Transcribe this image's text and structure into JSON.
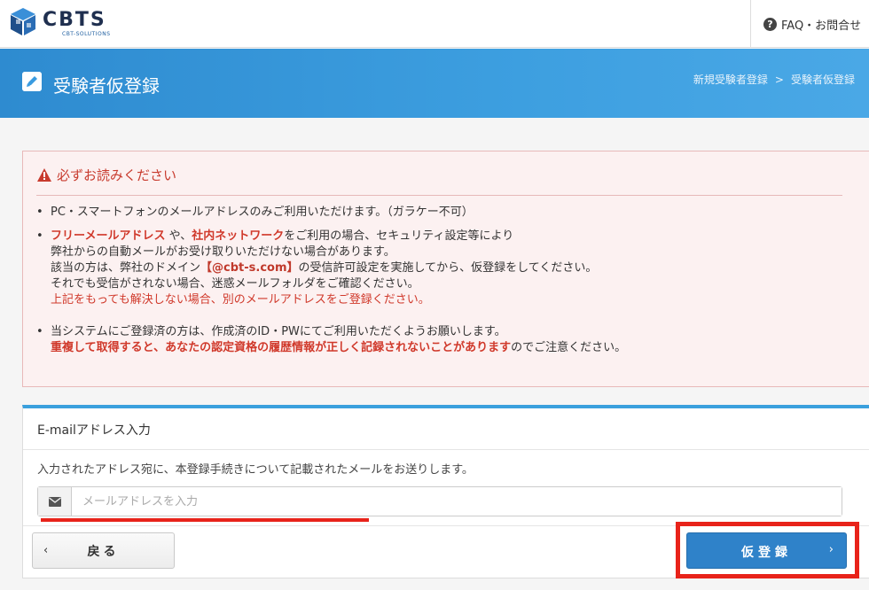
{
  "header": {
    "logo_text": "CBTS",
    "logo_sub": "CBT-SOLUTIONS",
    "faq_label": "FAQ・お問合せ"
  },
  "banner": {
    "title": "受験者仮登録",
    "breadcrumb": [
      "新規受験者登録",
      "受験者仮登録"
    ],
    "breadcrumb_sep": ">"
  },
  "notice": {
    "title": "必ずお読みください",
    "item1": "PC・スマートフォンのメールアドレスのみご利用いただけます。（ガラケー不可）",
    "item2": {
      "free_mail": "フリーメールアドレス",
      "ya": " や、",
      "company_net": "社内ネットワーク",
      "rest": "をご利用の場合、セキュリティ設定等により",
      "line2": "弊社からの自動メールがお受け取りいただけない場合があります。",
      "line3_a": "該当の方は、弊社のドメイン",
      "domain": "【@cbt-s.com】",
      "line3_b": "の受信許可設定を実施してから、仮登録をしてください。",
      "line4": "それでも受信がされない場合、迷惑メールフォルダをご確認ください。",
      "line5": "上記をもっても解決しない場合、別のメールアドレスをご登録ください。"
    },
    "item3": {
      "line1": "当システムにご登録済の方は、作成済のID・PWにてご利用いただくようお願いします。",
      "warn": "重複して取得すると、あなたの認定資格の履歴情報が正しく記録されないことがあります",
      "tail": "のでご注意ください。"
    }
  },
  "form": {
    "title": "E-mailアドレス入力",
    "description": "入力されたアドレス宛に、本登録手続きについて記載されたメールをお送りします。",
    "email_placeholder": "メールアドレスを入力",
    "email_value": ""
  },
  "buttons": {
    "back_label": "戻る",
    "back_chevron": "‹",
    "submit_label": "仮登録",
    "submit_chevron": "›"
  },
  "colors": {
    "accent_blue": "#2f82c9",
    "alert_red": "#d0392b",
    "highlight_red": "#e8231a"
  },
  "icons": {
    "faq": "question-circle-icon",
    "banner": "pencil-square-icon",
    "alert": "warning-triangle-icon",
    "email": "envelope-icon"
  }
}
